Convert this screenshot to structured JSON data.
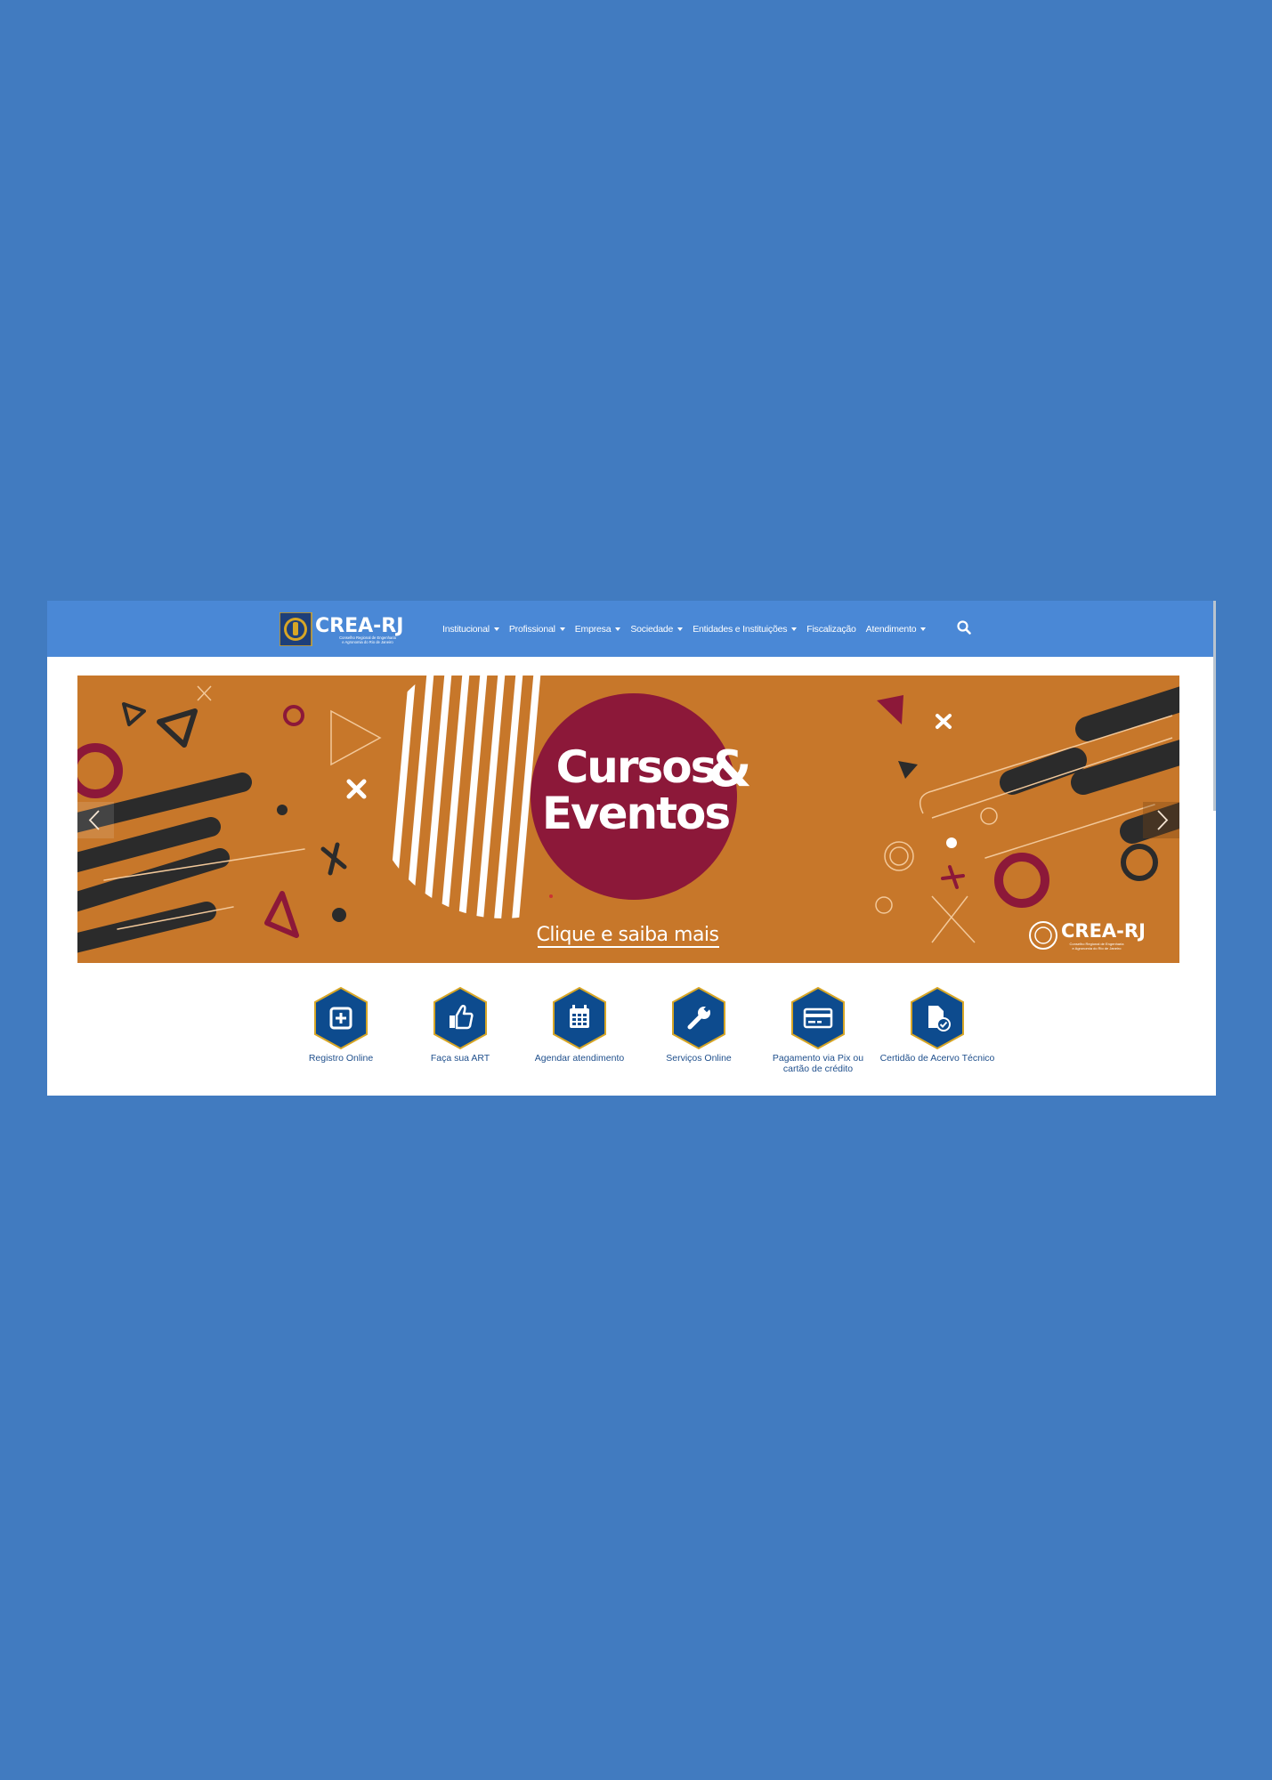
{
  "nav": {
    "brand": "CREA-RJ",
    "brand_sub_1": "Conselho Regional de Engenharia",
    "brand_sub_2": "e Agronomia do Rio de Janeiro",
    "items": [
      {
        "label": "Institucional",
        "dropdown": true
      },
      {
        "label": "Profissional",
        "dropdown": true
      },
      {
        "label": "Empresa",
        "dropdown": true
      },
      {
        "label": "Sociedade",
        "dropdown": true
      },
      {
        "label": "Entidades e Instituições",
        "dropdown": true
      },
      {
        "label": "Fiscalização",
        "dropdown": false
      },
      {
        "label": "Atendimento",
        "dropdown": true
      }
    ],
    "search_icon": "search-icon"
  },
  "banner": {
    "line1": "Cursos",
    "amp": "&",
    "line2": "Eventos",
    "cta": "Clique e saiba mais",
    "brand": "CREA-RJ",
    "brand_sub_1": "Conselho Regional de Engenharia",
    "brand_sub_2": "e Agronomia do Rio de Janeiro",
    "colors": {
      "background": "#c7772a",
      "circle": "#8c1839",
      "dark": "#2b2b2b"
    }
  },
  "quick_access": [
    {
      "label": "Registro Online",
      "icon": "plus-square-icon"
    },
    {
      "label": "Faça sua ART",
      "icon": "thumbs-up-icon"
    },
    {
      "label": "Agendar atendimento",
      "icon": "calendar-icon"
    },
    {
      "label": "Serviços Online",
      "icon": "wrench-icon"
    },
    {
      "label": "Pagamento via Pix ou cartão de crédito",
      "icon": "credit-card-icon"
    },
    {
      "label": "Certidão de Acervo Técnico",
      "icon": "certificate-file-icon"
    }
  ],
  "colors": {
    "page_bg": "#417bc0",
    "nav_bg": "#4a88d6",
    "hex_fill": "#0d4b8e",
    "hex_border": "#d7a626",
    "label": "#1f4f8c"
  }
}
